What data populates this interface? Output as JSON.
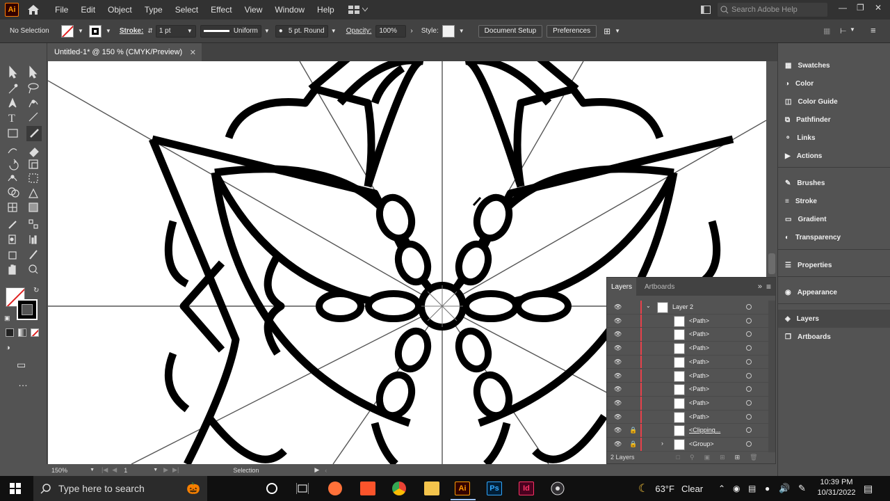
{
  "menubar": {
    "app_logo": "Ai",
    "items": [
      "File",
      "Edit",
      "Object",
      "Type",
      "Select",
      "Effect",
      "View",
      "Window",
      "Help"
    ],
    "search_placeholder": "Search Adobe Help"
  },
  "control": {
    "selection": "No Selection",
    "stroke_label": "Stroke:",
    "stroke_weight": "1 pt",
    "profile": "Uniform",
    "brush": "5 pt. Round",
    "opacity_label": "Opacity:",
    "opacity": "100%",
    "style_label": "Style:",
    "doc_setup": "Document Setup",
    "preferences": "Preferences"
  },
  "document": {
    "tab_title": "Untitled-1* @ 150 % (CMYK/Preview)",
    "zoom": "150%",
    "artboard": "1",
    "status": "Selection"
  },
  "right_panels": {
    "group1": [
      "Swatches",
      "Color",
      "Color Guide",
      "Pathfinder",
      "Links",
      "Actions"
    ],
    "group2": [
      "Brushes",
      "Stroke",
      "Gradient",
      "Transparency"
    ],
    "group3": [
      "Properties"
    ],
    "group4": [
      "Appearance"
    ],
    "group5": [
      "Layers",
      "Artboards"
    ]
  },
  "layers_panel": {
    "tabs": [
      "Layers",
      "Artboards"
    ],
    "rows": [
      {
        "name": "Layer 2"
      },
      {
        "name": "<Path>"
      },
      {
        "name": "<Path>"
      },
      {
        "name": "<Path>"
      },
      {
        "name": "<Path>"
      },
      {
        "name": "<Path>"
      },
      {
        "name": "<Path>"
      },
      {
        "name": "<Path>"
      },
      {
        "name": "<Path>"
      },
      {
        "name": "<Clipping..."
      },
      {
        "name": "<Group>"
      }
    ],
    "footer": "2 Layers"
  },
  "taskbar": {
    "search_placeholder": "Type here to search",
    "apps": [
      "Ai",
      "Ps",
      "Id"
    ],
    "weather_temp": "63°F",
    "weather_desc": "Clear",
    "time": "10:39 PM",
    "date": "10/31/2022"
  },
  "colors": {
    "illustrator_orange": "#ff9a00",
    "photoshop_blue": "#31a8ff",
    "indesign_pink": "#ff3366",
    "layer_red": "#e8414b"
  }
}
